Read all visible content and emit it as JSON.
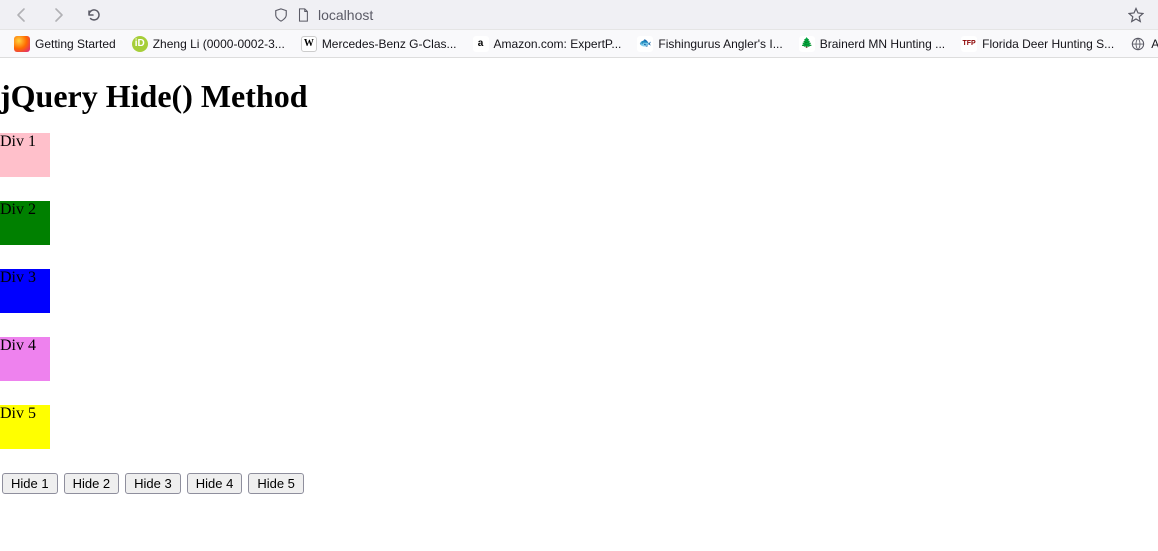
{
  "browser": {
    "url": "localhost"
  },
  "bookmarks": [
    {
      "label": "Getting Started",
      "iconClass": "bm-firefox",
      "iconText": ""
    },
    {
      "label": "Zheng Li (0000-0002-3...",
      "iconClass": "bm-orcid",
      "iconText": "iD"
    },
    {
      "label": "Mercedes-Benz G-Clas...",
      "iconClass": "bm-wiki",
      "iconText": "W"
    },
    {
      "label": "Amazon.com: ExpertP...",
      "iconClass": "bm-amazon",
      "iconText": "a"
    },
    {
      "label": "Fishingurus Angler's I...",
      "iconClass": "bm-fish",
      "iconText": "🐟"
    },
    {
      "label": "Brainerd MN Hunting ...",
      "iconClass": "bm-tree",
      "iconText": "🌲"
    },
    {
      "label": "Florida Deer Hunting S...",
      "iconClass": "bm-tfp",
      "iconText": "TFP"
    },
    {
      "label": "Another res",
      "iconClass": "bm-globe",
      "iconText": ""
    }
  ],
  "page": {
    "heading": "jQuery Hide() Method",
    "divs": [
      {
        "label": "Div 1",
        "colorClass": "div1",
        "color": "#ffc0cb"
      },
      {
        "label": "Div 2",
        "colorClass": "div2",
        "color": "#008000"
      },
      {
        "label": "Div 3",
        "colorClass": "div3",
        "color": "#0000ff"
      },
      {
        "label": "Div 4",
        "colorClass": "div4",
        "color": "#ee82ee"
      },
      {
        "label": "Div 5",
        "colorClass": "div5",
        "color": "#ffff00"
      }
    ],
    "buttons": [
      {
        "label": "Hide 1"
      },
      {
        "label": "Hide 2"
      },
      {
        "label": "Hide 3"
      },
      {
        "label": "Hide 4"
      },
      {
        "label": "Hide 5"
      }
    ]
  }
}
